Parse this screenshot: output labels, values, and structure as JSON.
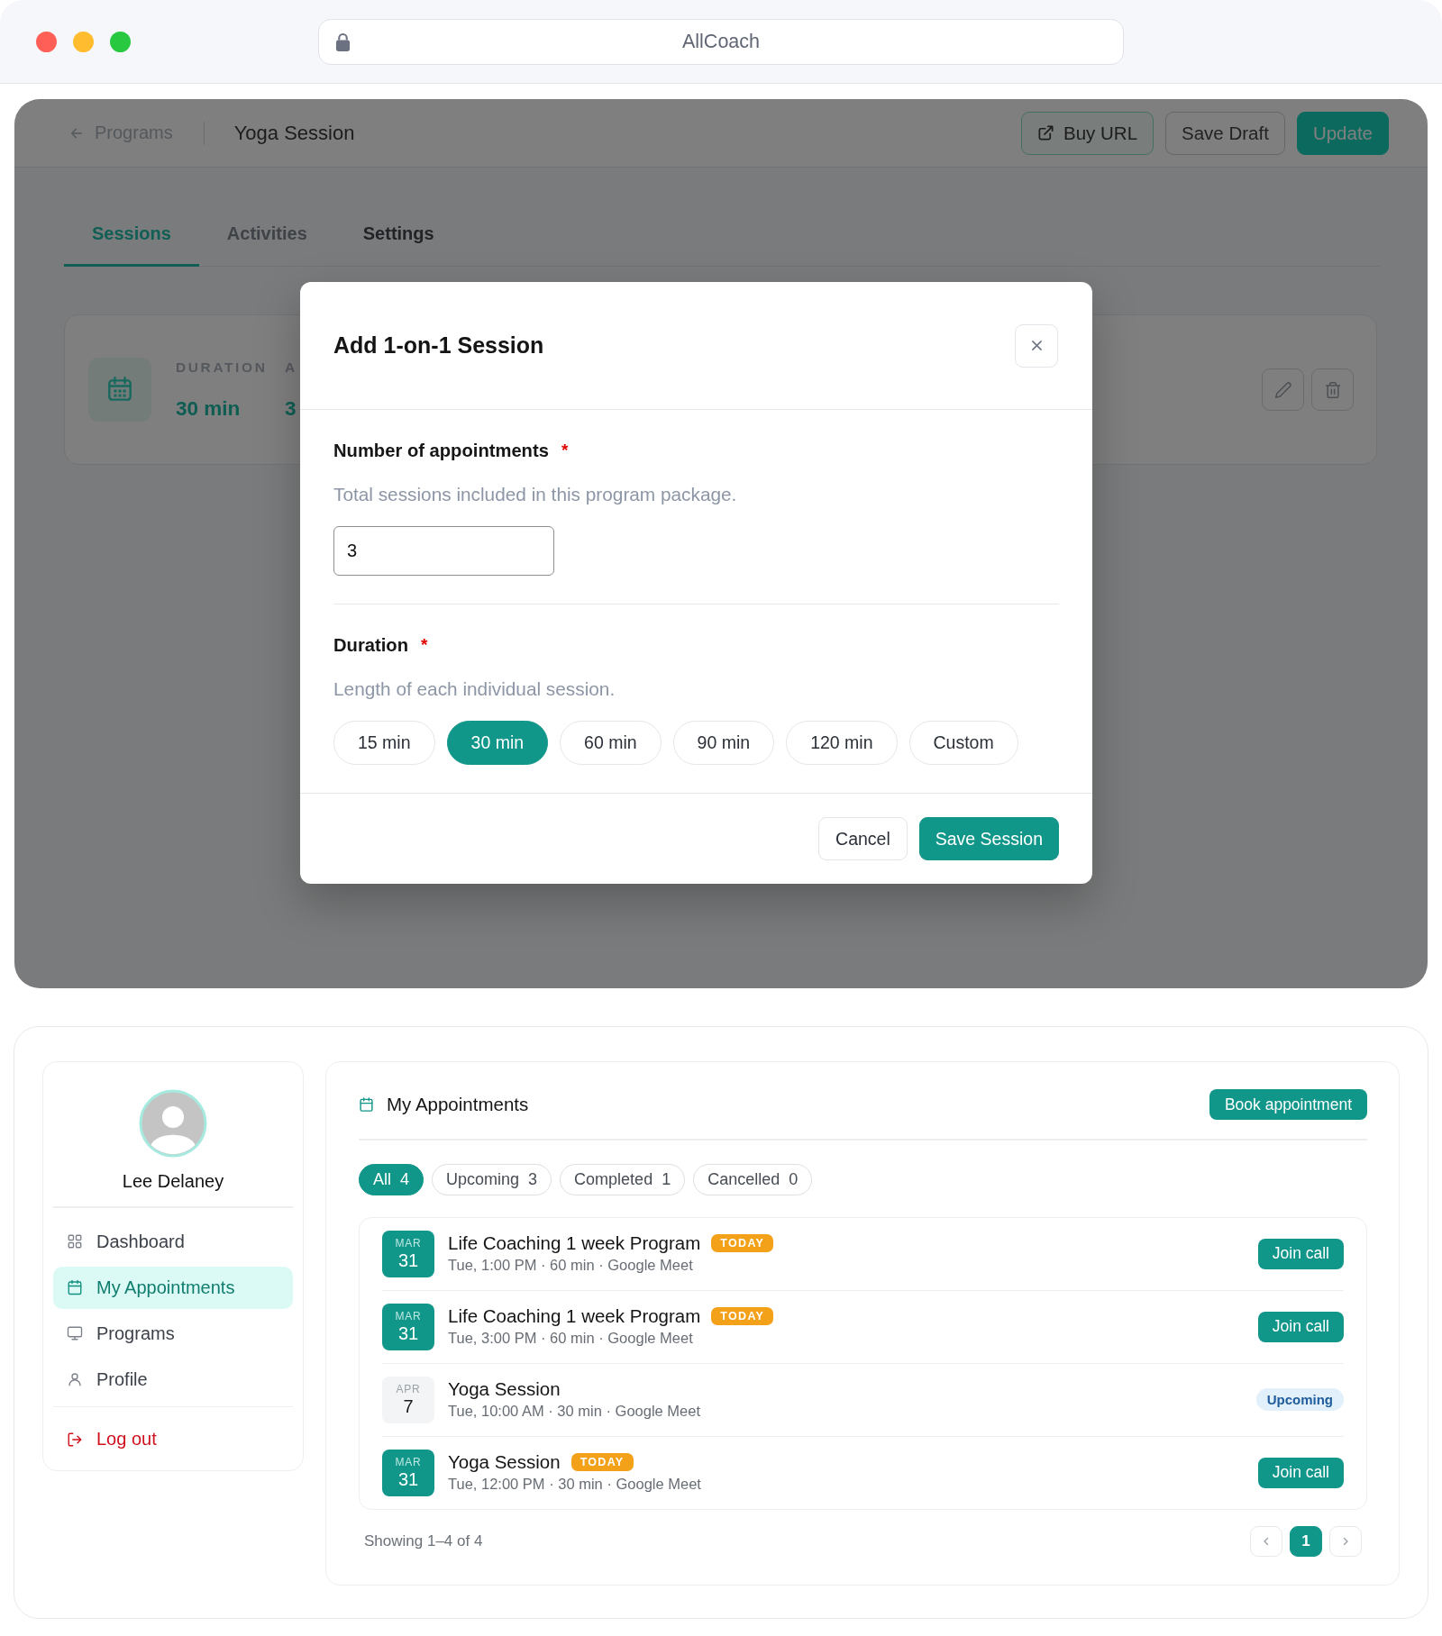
{
  "browser": {
    "address": "AllCoach"
  },
  "header": {
    "back_link": "Programs",
    "title": "Yoga Session",
    "buttons": [
      {
        "label": "Buy URL",
        "kind": "link"
      },
      {
        "label": "Save Draft",
        "kind": "secondary"
      },
      {
        "label": "Update",
        "kind": "primary"
      }
    ]
  },
  "tabs": [
    {
      "label": "Sessions",
      "selected": true,
      "disabled": false
    },
    {
      "label": "Activities",
      "selected": false,
      "disabled": true
    },
    {
      "label": "Settings",
      "selected": false,
      "disabled": false
    }
  ],
  "session_card": {
    "fields": [
      {
        "label": "DURATION",
        "value": "30 min"
      },
      {
        "label": "A",
        "value": "3"
      }
    ]
  },
  "modal": {
    "title": "Add 1-on-1 Session",
    "sections": [
      {
        "kind": "number",
        "label": "Number of appointments",
        "required_mark": "*",
        "hint": "Total sessions included in this program package.",
        "value": "3"
      },
      {
        "kind": "choice",
        "label": "Duration",
        "required_mark": "*",
        "hint": "Length of each individual session.",
        "options": [
          {
            "label": "15 min",
            "selected": false
          },
          {
            "label": "30 min",
            "selected": true
          },
          {
            "label": "60 min",
            "selected": false
          },
          {
            "label": "90 min",
            "selected": false
          },
          {
            "label": "120 min",
            "selected": false
          },
          {
            "label": "Custom",
            "selected": false
          }
        ]
      }
    ],
    "buttons": [
      {
        "label": "Cancel",
        "kind": "secondary"
      },
      {
        "label": "Save Session",
        "kind": "primary"
      }
    ]
  },
  "sidebar": {
    "user_name": "Lee Delaney",
    "items": [
      {
        "label": "Dashboard",
        "selected": false
      },
      {
        "label": "My Appointments",
        "selected": true
      },
      {
        "label": "Programs",
        "selected": false
      },
      {
        "label": "Profile",
        "selected": false
      }
    ],
    "logout": "Log out"
  },
  "appointments": {
    "title": "My Appointments",
    "book_button": "Book appointment",
    "filters": [
      {
        "label": "All",
        "count": "4",
        "selected": true
      },
      {
        "label": "Upcoming",
        "count": "3",
        "selected": false
      },
      {
        "label": "Completed",
        "count": "1",
        "selected": false
      },
      {
        "label": "Cancelled",
        "count": "0",
        "selected": false
      }
    ],
    "items": [
      {
        "month": "MAR",
        "day": "31",
        "today": true,
        "title": "Life Coaching 1 week Program",
        "badge": "TODAY",
        "details": "Tue, 1:00 PM · 60 min · Google Meet",
        "action": {
          "kind": "button",
          "label": "Join call"
        }
      },
      {
        "month": "MAR",
        "day": "31",
        "today": true,
        "title": "Life Coaching 1 week Program",
        "badge": "TODAY",
        "details": "Tue, 3:00 PM · 60 min · Google Meet",
        "action": {
          "kind": "button",
          "label": "Join call"
        }
      },
      {
        "month": "APR",
        "day": "7",
        "today": false,
        "title": "Yoga Session",
        "details": "Tue, 10:00 AM · 30 min · Google Meet",
        "action": {
          "kind": "status",
          "label": "Upcoming"
        }
      },
      {
        "month": "MAR",
        "day": "31",
        "today": true,
        "title": "Yoga Session",
        "badge": "TODAY",
        "details": "Tue, 12:00 PM · 30 min · Google Meet",
        "action": {
          "kind": "button",
          "label": "Join call"
        }
      }
    ],
    "summary": "Showing 1–4 of 4",
    "pages": [
      {
        "label": "1",
        "selected": true
      }
    ]
  }
}
